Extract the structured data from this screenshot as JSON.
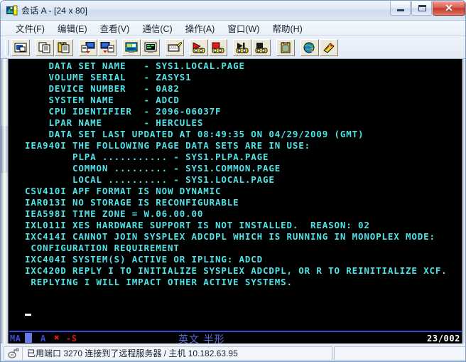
{
  "window": {
    "title": "会话 A - [24 x 80]",
    "icon": "session-icon",
    "minimize_label": "",
    "maximize_label": "",
    "close_label": "✕"
  },
  "menubar": {
    "items": [
      {
        "label": "文件(F)",
        "name": "menu-file"
      },
      {
        "label": "编辑(E)",
        "name": "menu-edit"
      },
      {
        "label": "查看(V)",
        "name": "menu-view"
      },
      {
        "label": "通信(C)",
        "name": "menu-communication"
      },
      {
        "label": "操作(A)",
        "name": "menu-actions"
      },
      {
        "label": "窗口(W)",
        "name": "menu-window"
      },
      {
        "label": "帮助(H)",
        "name": "menu-help"
      }
    ]
  },
  "toolbar": {
    "buttons": [
      {
        "name": "print-screen-icon",
        "icon": "printer-screen"
      },
      {
        "sep": true
      },
      {
        "name": "copy-icon",
        "icon": "copy"
      },
      {
        "name": "paste-icon",
        "icon": "paste"
      },
      {
        "sep": true
      },
      {
        "name": "send-file-icon",
        "icon": "send-file"
      },
      {
        "name": "receive-file-icon",
        "icon": "receive-file"
      },
      {
        "sep": true
      },
      {
        "name": "display-settings-icon",
        "icon": "display-setup"
      },
      {
        "name": "color-settings-icon",
        "icon": "color-setup"
      },
      {
        "sep": true
      },
      {
        "name": "keyboard-remap-icon",
        "icon": "keyboard"
      },
      {
        "sep": true
      },
      {
        "name": "record-macro-icon",
        "icon": "macro-record"
      },
      {
        "name": "stop-macro-icon",
        "icon": "macro-stop"
      },
      {
        "sep": true
      },
      {
        "name": "play-macro-icon",
        "icon": "macro-play"
      },
      {
        "name": "macro-stop2-icon",
        "icon": "macro-stop2"
      },
      {
        "sep": true
      },
      {
        "name": "clipboard-icon",
        "icon": "clipboard"
      },
      {
        "sep": true
      },
      {
        "name": "internet-icon",
        "icon": "globe"
      },
      {
        "name": "support-icon",
        "icon": "key-support"
      }
    ]
  },
  "terminal": {
    "rows": 24,
    "cols": 80,
    "fg_color": "#4fe3e8",
    "bg_color": "#000000",
    "lines": [
      "    DATA SET NAME   - SYS1.LOCAL.PAGE",
      "    VOLUME SERIAL   - ZASYS1",
      "    DEVICE NUMBER   - 0A82",
      "    SYSTEM NAME     - ADCD",
      "    CPU IDENTIFIER  - 2096-06037F",
      "    LPAR NAME       - HERCULES",
      "    DATA SET LAST UPDATED AT 08:49:35 ON 04/29/2009 (GMT)",
      "IEA940I THE FOLLOWING PAGE DATA SETS ARE IN USE:",
      "        PLPA ........... - SYS1.PLPA.PAGE",
      "        COMMON ......... - SYS1.COMMON.PAGE",
      "        LOCAL .......... - SYS1.LOCAL.PAGE",
      "CSV410I APF FORMAT IS NOW DYNAMIC",
      "IAR013I NO STORAGE IS RECONFIGURABLE",
      "IEA598I TIME ZONE = W.06.00.00",
      "IXL011I XES HARDWARE SUPPORT IS NOT INSTALLED.  REASON: 02",
      "IXC414I CANNOT JOIN SYSPLEX ADCDPL WHICH IS RUNNING IN MONOPLEX MODE:",
      " CONFIGURATION REQUIREMENT",
      "IXC404I SYSTEM(S) ACTIVE OR IPLING: ADCD",
      "IXC420D REPLY I TO INITIALIZE SYSPLEX ADCDPL, OR R TO REINITIALIZE XCF.",
      " REPLYING I WILL IMPACT OTHER ACTIVE SYSTEMS."
    ]
  },
  "oia": {
    "connection_indicator": "MA",
    "session_letter": "A",
    "input_inhibit": "✖",
    "system_wait": "-S",
    "ime_mode": "英文 半形",
    "cursor_position": "23/002"
  },
  "statusbar": {
    "icon": "connection-icon",
    "message": "已用端口 3270 连接到了远程服务器 / 主机 10.182.63.95"
  }
}
